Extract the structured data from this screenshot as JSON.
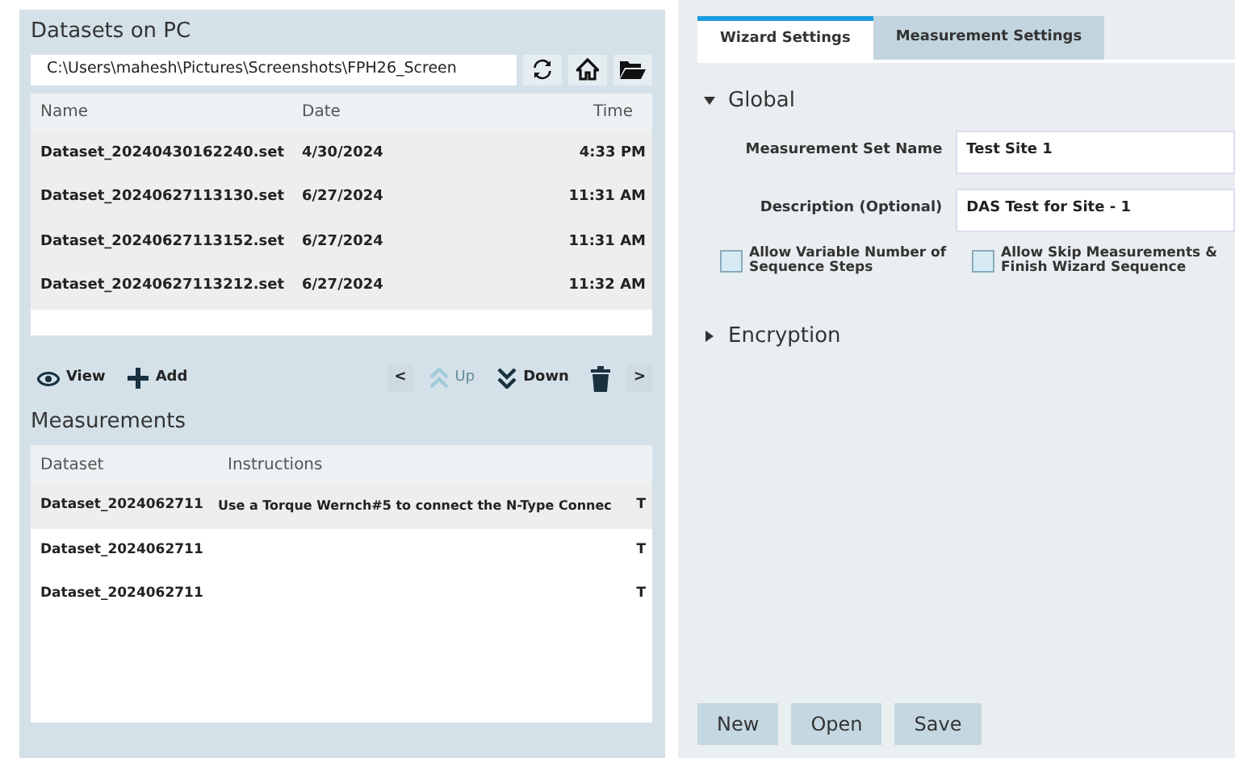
{
  "datasets_panel": {
    "title": "Datasets on PC",
    "path": "C:\\Users\\mahesh\\Pictures\\Screenshots\\FPH26_Screen",
    "table": {
      "columns": [
        "Name",
        "Date",
        "Time"
      ],
      "rows": [
        {
          "cells": [
            "Dataset_20240430162240.set",
            "4/30/2024",
            "4:33 PM"
          ]
        },
        {
          "cells": [
            "Dataset_20240627113130.set",
            "6/27/2024",
            "11:31 AM"
          ]
        },
        {
          "cells": [
            "Dataset_20240627113152.set",
            "6/27/2024",
            "11:31 AM"
          ]
        },
        {
          "cells": [
            "Dataset_20240627113212.set",
            "6/27/2024",
            "11:32 AM"
          ]
        }
      ]
    },
    "toolbar": [
      {
        "kind": "view",
        "label": "View",
        "disabled": false
      },
      {
        "kind": "add",
        "label": "Add",
        "disabled": false
      },
      {
        "kind": "prev",
        "label": "<",
        "disabled": false
      },
      {
        "kind": "up",
        "label": "Up",
        "disabled": true
      },
      {
        "kind": "down",
        "label": "Down",
        "disabled": false
      },
      {
        "kind": "delete",
        "disabled": false
      },
      {
        "kind": "next",
        "label": ">",
        "disabled": false
      }
    ]
  },
  "measurements_panel": {
    "title": "Measurements",
    "table": {
      "columns": [
        "Dataset",
        "Instructions"
      ],
      "rows": [
        {
          "selected": true,
          "dataset": "Dataset_2024062711",
          "instructions": "Use a Torque Wernch#5 to connect the N-Type Connec",
          "column_3": "T"
        },
        {
          "selected": false,
          "dataset": "Dataset_2024062711",
          "column_3": "T"
        },
        {
          "selected": false,
          "dataset": "Dataset_2024062711",
          "column_3": "T"
        }
      ]
    }
  },
  "tabs": [
    {
      "label": "Wizard Settings",
      "selected": true
    },
    {
      "label": "Measurement Settings",
      "selected": false
    }
  ],
  "sections": [
    {
      "title": "Global",
      "expanded": true,
      "fields": [
        {
          "label": "Measurement Set Name",
          "value": "Test Site 1"
        },
        {
          "label": "Description (Optional)",
          "value": "DAS Test for Site - 1"
        }
      ],
      "checkboxes": [
        {
          "label": "Allow Variable Number of Sequence Steps",
          "checked": false
        },
        {
          "label": "Allow Skip Measurements & Finish Wizard Sequence",
          "checked": false
        }
      ]
    },
    {
      "title": "Encryption",
      "expanded": false
    }
  ],
  "buttons": [
    "New",
    "Open",
    "Save"
  ]
}
